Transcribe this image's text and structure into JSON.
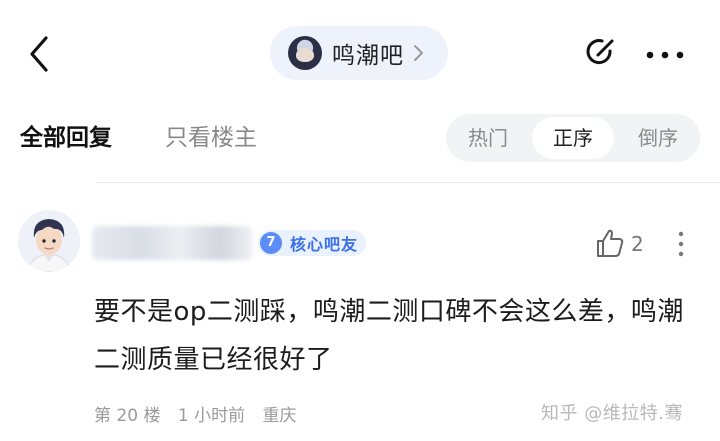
{
  "header": {
    "forum_name": "鸣潮吧"
  },
  "tabs": {
    "all_replies": "全部回复",
    "owner_only": "只看楼主"
  },
  "sort": {
    "options": [
      "热门",
      "正序",
      "倒序"
    ],
    "selected": "正序"
  },
  "comment": {
    "badge_level": "7",
    "badge_label": "核心吧友",
    "like_count": "2",
    "text": "要不是op二测踩，鸣潮二测口碑不会这么差，鸣潮二测质量已经很好了",
    "floor": "第 20 楼",
    "time": "1 小时前",
    "location": "重庆"
  },
  "watermark": "知乎 @维拉特.骞",
  "colors": {
    "accent_blue": "#3a6fe8",
    "pill_bg": "#eef2fb",
    "segment_bg": "#f2f3f5"
  }
}
